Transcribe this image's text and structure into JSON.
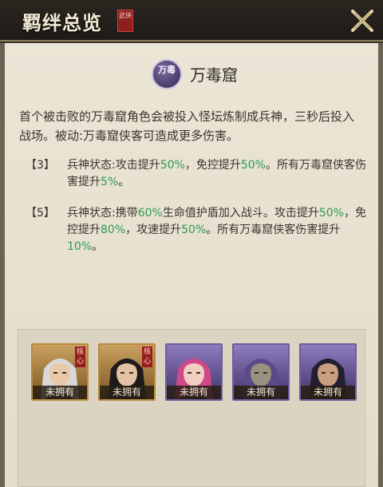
{
  "header": {
    "title": "羁绊总览",
    "seal_text": "武侠"
  },
  "faction": {
    "emblem_text": "万毒",
    "name": "万毒窟"
  },
  "description": "首个被击败的万毒窟角色会被投入怪坛炼制成兵神，三秒后投入战场。被动:万毒窟侠客可造成更多伤害。",
  "tiers": [
    {
      "label": "【3】",
      "segments": [
        "兵神状态:攻击提升",
        "50%",
        "，免控提升",
        "50%",
        "。所有万毒窟侠客伤害提升",
        "5%",
        "。"
      ]
    },
    {
      "label": "【5】",
      "segments": [
        "兵神状态:携带",
        "60%",
        "生命值护盾加入战斗。攻击提升",
        "50%",
        "，免控提升",
        "80%",
        "，攻速提升",
        "50%",
        "。所有万毒窟侠客伤害提升",
        "10%",
        "。"
      ]
    }
  ],
  "heroes": [
    {
      "rarity": "gold",
      "core_tag": "核心",
      "status": "未拥有",
      "hair": "#d8d8d8",
      "skin": "#e8c8a8"
    },
    {
      "rarity": "gold",
      "core_tag": "核心",
      "status": "未拥有",
      "hair": "#1c1a1a",
      "skin": "#e2c2a2"
    },
    {
      "rarity": "purple",
      "core_tag": "",
      "status": "未拥有",
      "hair": "#d0488a",
      "skin": "#f0cfc0"
    },
    {
      "rarity": "purple",
      "core_tag": "",
      "status": "未拥有",
      "hair": "#5a4a8a",
      "skin": "#9a9080"
    },
    {
      "rarity": "purple",
      "core_tag": "",
      "status": "未拥有",
      "hair": "#222030",
      "skin": "#c8a080"
    }
  ],
  "colors": {
    "highlight": "#2e9a52",
    "panel_bg": "#e6dfcf",
    "header_bg": "#1e1a16"
  }
}
